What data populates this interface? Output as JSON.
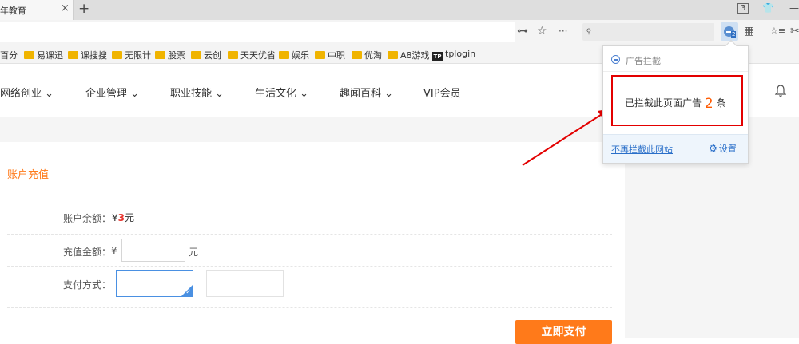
{
  "tabbar": {
    "tab_title": "年教育",
    "close_glyph": "×",
    "new_tab_glyph": "+",
    "tab_count": "3",
    "shirt_glyph": "👕",
    "minimize_glyph": "—"
  },
  "addressbar": {
    "key_glyph": "⊶",
    "star_glyph": "☆",
    "more_glyph": "···",
    "search_glyph": "⌕",
    "grid_glyph": "▦",
    "fav_glyph": "☆≡",
    "cut_glyph": "✂"
  },
  "bookmarks": [
    {
      "label": "百分"
    },
    {
      "label": "易课迅"
    },
    {
      "label": "课搜搜"
    },
    {
      "label": "无限计"
    },
    {
      "label": "股票"
    },
    {
      "label": "云创"
    },
    {
      "label": "天天优省"
    },
    {
      "label": "娱乐"
    },
    {
      "label": "中职"
    },
    {
      "label": "优淘"
    },
    {
      "label": "A8游戏"
    },
    {
      "label": "tplogin",
      "logo": "TP"
    }
  ],
  "nav": {
    "items": [
      {
        "label": "网络创业 ⌄"
      },
      {
        "label": "企业管理 ⌄"
      },
      {
        "label": "职业技能 ⌄"
      },
      {
        "label": "生活文化 ⌄"
      },
      {
        "label": "趣闻百科 ⌄"
      },
      {
        "label": "VIP会员"
      }
    ],
    "bell_glyph": "🔔"
  },
  "recharge": {
    "section_title": "账户充值",
    "balance_label": "账户余额：",
    "balance_currency": "¥",
    "balance_value": "3",
    "balance_unit": "元",
    "amount_label": "充值金额：",
    "amount_currency": "¥",
    "amount_value": "",
    "amount_unit": "元",
    "pay_method_label": "支付方式：",
    "pay_button": "立即支付"
  },
  "adblock_popup": {
    "title": "广告拦截",
    "message_prefix": "已拦截此页面广告",
    "count": "2",
    "message_suffix": "条",
    "disable_link": "不再拦截此网站",
    "settings_label": "设置"
  },
  "colors": {
    "accent": "#ff7a1a",
    "highlight_box": "#e30000",
    "link": "#2a6fc9"
  }
}
